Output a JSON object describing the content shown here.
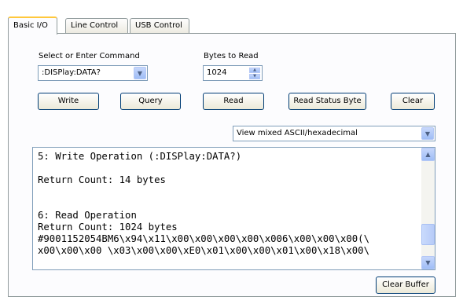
{
  "tabs": [
    {
      "label": "Basic I/O",
      "active": true
    },
    {
      "label": "Line Control",
      "active": false
    },
    {
      "label": "USB Control",
      "active": false
    }
  ],
  "command": {
    "label": "Select or Enter Command",
    "value": ":DISPlay:DATA?"
  },
  "bytes": {
    "label": "Bytes to Read",
    "value": "1024"
  },
  "buttons": {
    "write": "Write",
    "query": "Query",
    "read": "Read",
    "read_status": "Read Status Byte",
    "clear": "Clear",
    "clear_buffer": "Clear Buffer"
  },
  "view_mode": {
    "value": "View mixed ASCII/hexadecimal"
  },
  "output_lines": [
    "5: Write Operation (:DISPlay:DATA?)",
    "",
    "Return Count: 14 bytes",
    "",
    "",
    "6: Read Operation",
    "Return Count: 1024 bytes",
    "#9001152054BM6\\x94\\x11\\x00\\x00\\x00\\x00\\x006\\x00\\x00\\x00(\\",
    "x00\\x00\\x00 \\x03\\x00\\x00\\xE0\\x01\\x00\\x00\\x01\\x00\\x18\\x00\\"
  ],
  "icons": {
    "dropdown": "chevron-down-icon",
    "scroll_up": "arrow-up-icon",
    "scroll_down": "arrow-down-icon"
  },
  "colors": {
    "active_tab_highlight": "#ffc83c",
    "border": "#919b9c",
    "button_border": "#003c74",
    "field_border": "#7f9db9"
  }
}
